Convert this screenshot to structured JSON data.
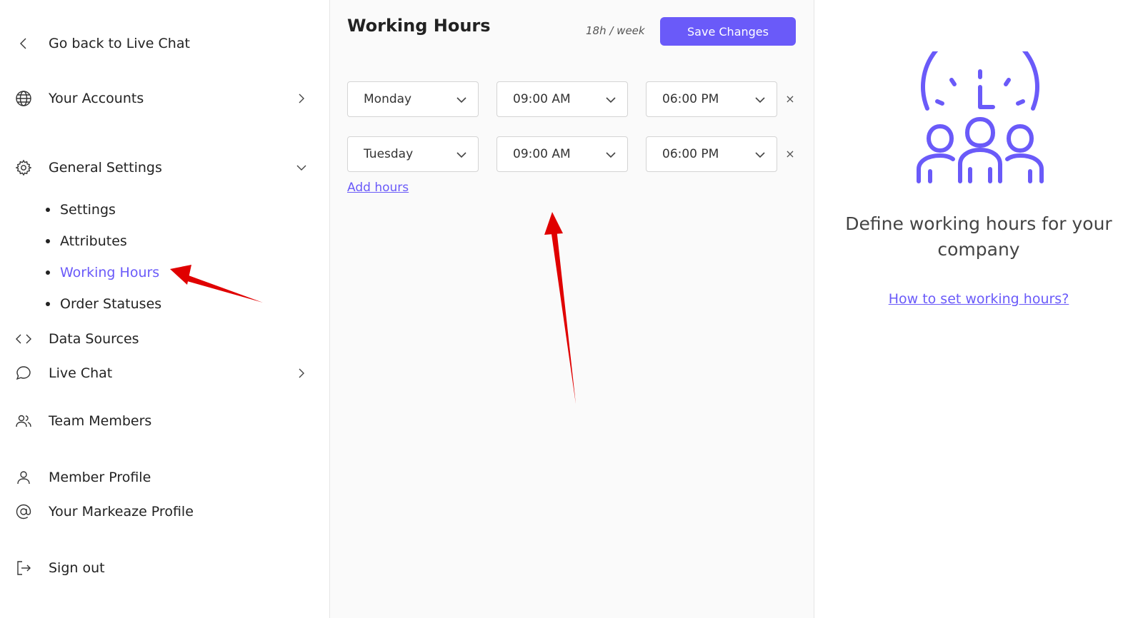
{
  "sidebar": {
    "back_label": "Go back to Live Chat",
    "accounts_label": "Your Accounts",
    "general_settings_label": "General Settings",
    "sub_items": [
      "Settings",
      "Attributes",
      "Working Hours",
      "Order Statuses"
    ],
    "active_sub_item": "Working Hours",
    "data_sources_label": "Data Sources",
    "live_chat_label": "Live Chat",
    "team_members_label": "Team Members",
    "member_profile_label": "Member Profile",
    "markeaze_profile_label": "Your Markeaze Profile",
    "sign_out_label": "Sign out"
  },
  "main": {
    "title": "Working Hours",
    "hours_per_week": "18h / week",
    "save_label": "Save Changes",
    "rows": [
      {
        "day": "Monday",
        "start": "09:00 AM",
        "end": "06:00 PM"
      },
      {
        "day": "Tuesday",
        "start": "09:00 AM",
        "end": "06:00 PM"
      }
    ],
    "remove_glyph": "×",
    "add_hours_label": "Add hours"
  },
  "right": {
    "help_text": "Define working hours for your company",
    "help_link": "How to set working hours?"
  },
  "colors": {
    "accent": "#6a5af9",
    "annotation": "#e00000"
  },
  "icons": {
    "back": "chevron-left-icon",
    "accounts": "globe-icon",
    "general_settings": "gear-icon",
    "data_sources": "code-icon",
    "live_chat": "chat-bubble-icon",
    "team_members": "users-icon",
    "member_profile": "user-icon",
    "markeaze_profile": "at-sign-icon",
    "sign_out": "logout-icon"
  }
}
